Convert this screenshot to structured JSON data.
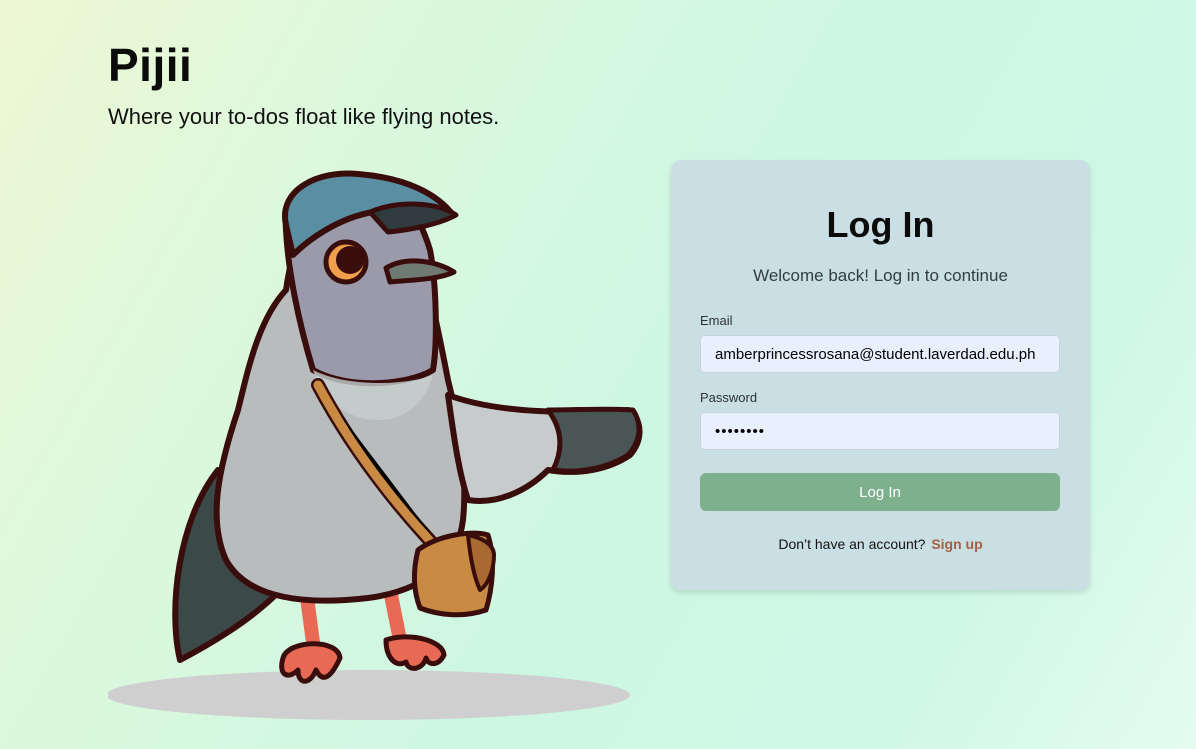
{
  "app": {
    "title": "Pijii",
    "tagline": "Where your to-dos float like flying notes."
  },
  "login": {
    "heading": "Log In",
    "subtitle": "Welcome back! Log in to continue",
    "email_label": "Email",
    "email_value": "amberprincessrosana@student.laverdad.edu.ph",
    "password_label": "Password",
    "password_value": "password",
    "submit_label": "Log In",
    "signup_prompt": "Don’t have an account?",
    "signup_link": "Sign up"
  },
  "colors": {
    "button": "#7fb08d",
    "card": "#c9dfe3",
    "link": "#a5603f",
    "input": "#e8f0fe"
  },
  "icons": {
    "mascot": "pigeon-mailcarrier-illustration"
  }
}
